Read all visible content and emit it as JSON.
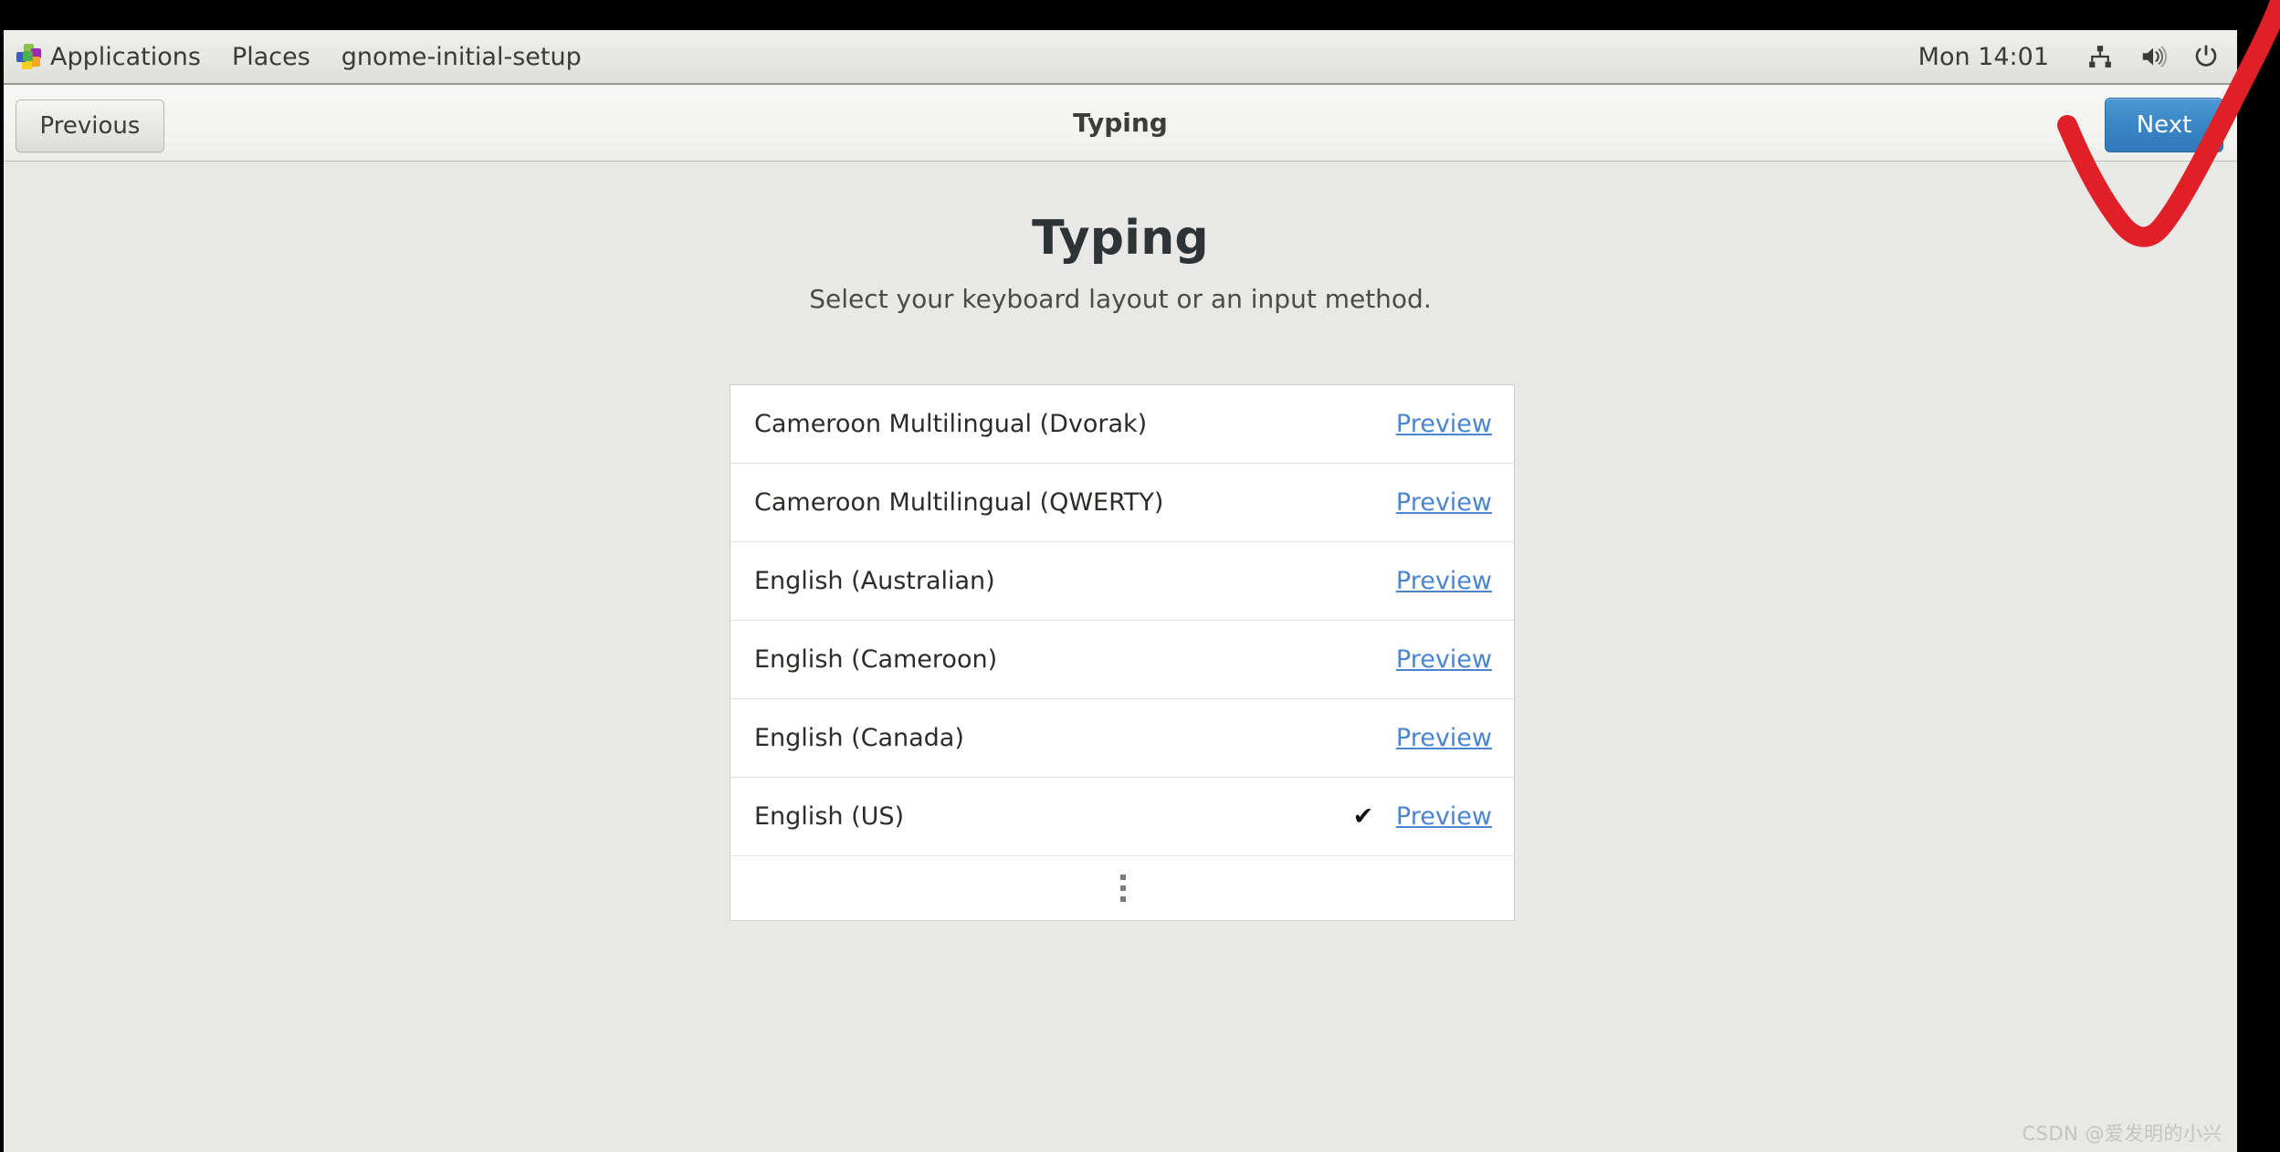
{
  "panel": {
    "logo_icon": "gnome-applications-icon",
    "items": [
      {
        "label": "Applications"
      },
      {
        "label": "Places"
      },
      {
        "label": "gnome-initial-setup"
      }
    ],
    "clock": "Mon 14:01",
    "tray": [
      {
        "icon": "wired-network-icon"
      },
      {
        "icon": "volume-icon"
      },
      {
        "icon": "power-icon"
      }
    ]
  },
  "headerbar": {
    "previous_label": "Previous",
    "title": "Typing",
    "next_label": "Next"
  },
  "page": {
    "heading": "Typing",
    "subheading": "Select your keyboard layout or an input method."
  },
  "keyboard_list": {
    "preview_label": "Preview",
    "check_glyph": "✔",
    "more_icon": "more-options-icon",
    "rows": [
      {
        "name": "Cameroon Multilingual (Dvorak)",
        "selected": false
      },
      {
        "name": "Cameroon Multilingual (QWERTY)",
        "selected": false
      },
      {
        "name": "English (Australian)",
        "selected": false
      },
      {
        "name": "English (Cameroon)",
        "selected": false
      },
      {
        "name": "English (Canada)",
        "selected": false
      },
      {
        "name": "English (US)",
        "selected": true
      }
    ]
  },
  "watermark": "CSDN @爱发明的小兴",
  "colors": {
    "accent_blue": "#3a86c6",
    "link_blue": "#4a86cf",
    "annotation_red": "#e01f26",
    "panel_bg": "#e9e9e6",
    "content_bg": "#e8e8e6"
  }
}
